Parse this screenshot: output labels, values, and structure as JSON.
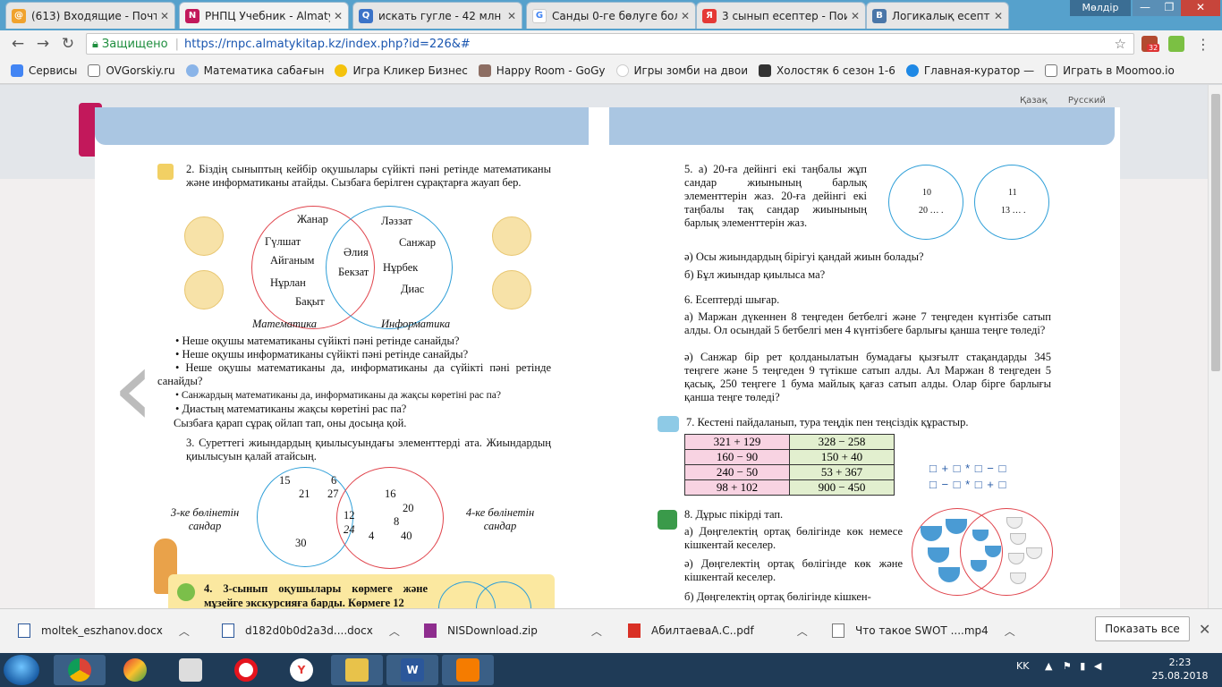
{
  "browser": {
    "tabs": [
      {
        "title": "(613) Входящие - Почта",
        "favicon": "mail-icon",
        "color": "#f0a22d"
      },
      {
        "title": "РНПЦ Учебник - Almaty",
        "favicon": "book-icon",
        "color": "#c2185b"
      },
      {
        "title": "искать гугле - 42 млн р",
        "favicon": "search-icon",
        "color": "#3b73c8"
      },
      {
        "title": "Санды 0-ге бөлуге бола",
        "favicon": "google-icon",
        "color": "#4285f4"
      },
      {
        "title": "3 сынып есептер - Поис",
        "favicon": "yandex-icon",
        "color": "#e53935"
      },
      {
        "title": "Логикалық есептер, ма",
        "favicon": "vk-icon",
        "color": "#4a76a8"
      }
    ],
    "user_menu": "Мөлдір",
    "address": {
      "secure_label": "Защищено",
      "url": "https://rnpc.almatykitap.kz/index.php?id=226&#"
    },
    "extension_badge": "32",
    "bookmarks": [
      "Сервисы",
      "OVGorskiy.ru",
      "Математика сабағын",
      "Игра Кликер Бизнес",
      "Happy Room - GoGy",
      "Игры зомби на двои",
      "Холостяк 6 сезон 1-6",
      "Главная-куратор —",
      "Играть в Moomoo.io"
    ]
  },
  "site": {
    "languages": [
      "Қазақ",
      "Русский"
    ]
  },
  "left_page": {
    "task2_title": "2. Біздің сыныптың кейбір оқушылары сүйікті пәні ретінде математиканы және информатиканы атайды. Сызбаға берілген сұрақтарға жауап бер.",
    "venn_math_only": [
      "Гүлшат",
      "Айганым",
      "Нұрлан",
      "Бақыт"
    ],
    "venn_top": "Жанар",
    "venn_both": [
      "Әлия",
      "Бекзат"
    ],
    "venn_info_only": [
      "Ләззат",
      "Санжар",
      "Нұрбек",
      "Диас"
    ],
    "label_math": "Математика",
    "label_info": "Информатика",
    "questions": [
      "• Неше оқушы математиканы сүйікті пәні ретінде санайды?",
      "• Неше оқушы информатиканы сүйікті пәні ретінде санайды?",
      "• Неше оқушы математиканы да, информатиканы да сүйікті пәні ретінде санайды?",
      "• Санжардың математиканы да, информатиканы да жақсы көретіні рас па?",
      "• Диастың математиканы жақсы көретіні рас па?"
    ],
    "task2_note": "Сызбаға қарап сұрақ ойлап тап, оны досыңа қой.",
    "task3_title": "3. Суреттегі жиындардың қиылысуындағы элементтерді ата. Жиындардың қиылысуын қалай атайсың.",
    "label_div3": "3-ке бөлінетін сандар",
    "label_div4": "4-ке бөлінетін сандар",
    "div3_only": [
      "15",
      "6",
      "21",
      "27",
      "30"
    ],
    "div_both": [
      "12",
      "24"
    ],
    "div4_only": [
      "16",
      "20",
      "8",
      "4",
      "40"
    ],
    "task4_text": "4. 3-сынып оқушылары көрмеге және мұзейге экскурсияға барды. Көрмеге 12"
  },
  "right_page": {
    "task5_text": "5. а) 20-ға дейінгі екі таңбалы жұп сандар жиынының барлық элементтерін жаз. 20-ға дейінгі екі таңбалы тақ сандар жиынының барлық элементтерін жаз.",
    "circle_even": [
      "10",
      "20 … ."
    ],
    "circle_odd": [
      "11",
      "13 … ."
    ],
    "task5_a2": "ә) Осы жиындардың бірігуі қандай жиын болады?",
    "task5_b": "б) Бұл жиындар қиылыса ма?",
    "task6_title": "6. Есептерді шығар.",
    "task6_a": "а) Маржан дүкеннен 8 теңгеден бетбелгі және 7 теңгеден күнтізбе сатып алды. Ол осындай 5 бетбелгі мен 4 күнтізбеге барлығы қанша теңге төледі?",
    "task6_a2": "ә) Санжар бір рет қолданылатын бумадағы қызғылт стақандарды 345 теңгеге және 5 теңгеден 9 түтікше сатып алды. Ал Маржан 8 теңгеден 5 қасық, 250 теңгеге 1 бума майлық қағаз сатып алды. Олар бірге барлығы қанша теңге төледі?",
    "task7_title": "7. Кестені пайдаланып, тура теңдік пен теңсіздік құрастыр.",
    "table_left": [
      "321 + 129",
      "160 − 90",
      "240 − 50",
      "98 + 102"
    ],
    "table_right": [
      "328 − 258",
      "150 + 40",
      "53 + 367",
      "900 − 450"
    ],
    "patterns": [
      "□ + □ * □ − □",
      "□ − □ * □ + □"
    ],
    "task8_title": "8. Дұрыс пікірді тап.",
    "task8_a": "а) Дөңгелектің ортақ бөлігінде көк немесе кішкентай кеселер.",
    "task8_a2": "ә) Дөңгелектің ортақ бөлігінде көк және кішкентай кеселер.",
    "task8_b": "б) Дөңгелектің ортақ бөлігінде кішкен-"
  },
  "downloads": {
    "items": [
      "moltek_eszhanov.docx",
      "d182d0b0d2a3d....docx",
      "NISDownload.zip",
      "АбилтаеваА.С..pdf",
      "Что такое SWOT ....mp4"
    ],
    "show_all": "Показать все"
  },
  "taskbar": {
    "lang": "KK",
    "time": "2:23",
    "date": "25.08.2018"
  },
  "colors": {
    "titlebar": "#56a1cc",
    "page_header": "#aac6e2",
    "circle_blue": "#2f9fd8",
    "circle_red": "#e0444c",
    "table_pink": "#f8d3e2",
    "table_green": "#e2efcf",
    "task4_box": "#fbe8a0"
  }
}
